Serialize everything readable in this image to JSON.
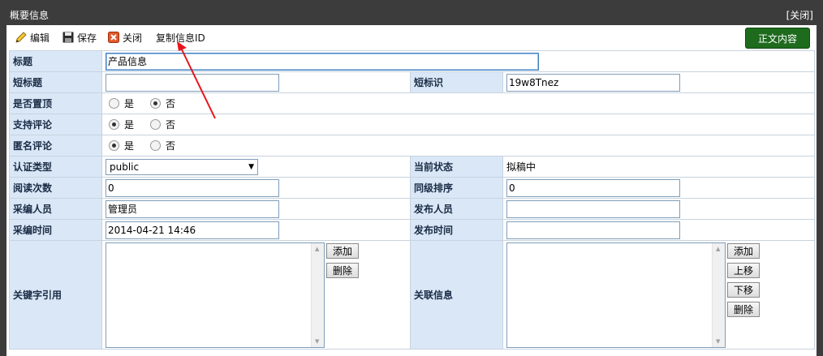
{
  "window": {
    "title": "概要信息",
    "close_label": "[关闭]"
  },
  "toolbar": {
    "edit": "编辑",
    "save": "保存",
    "close": "关闭",
    "copy_id": "复制信息ID",
    "content": "正文内容"
  },
  "form": {
    "title": {
      "label": "标题",
      "value": "产品信息"
    },
    "short_title": {
      "label": "短标题",
      "value": ""
    },
    "short_id": {
      "label": "短标识",
      "value": "19w8Tnez"
    },
    "pinned": {
      "label": "是否置顶",
      "yes": "是",
      "no": "否",
      "selected": "否"
    },
    "allow_comment": {
      "label": "支持评论",
      "yes": "是",
      "no": "否",
      "selected": "是"
    },
    "anonymous_comment": {
      "label": "匿名评论",
      "yes": "是",
      "no": "否",
      "selected": "是"
    },
    "auth_type": {
      "label": "认证类型",
      "value": "public"
    },
    "status": {
      "label": "当前状态",
      "value": "拟稿中"
    },
    "read_count": {
      "label": "阅读次数",
      "value": "0"
    },
    "sibling_order": {
      "label": "同级排序",
      "value": "0"
    },
    "editor": {
      "label": "采编人员",
      "value": "管理员"
    },
    "publisher": {
      "label": "发布人员",
      "value": ""
    },
    "edit_time": {
      "label": "采编时间",
      "value": "2014-04-21 14:46"
    },
    "publish_time": {
      "label": "发布时间",
      "value": ""
    },
    "keywords": {
      "label": "关键字引用",
      "add": "添加",
      "delete": "删除"
    },
    "related": {
      "label": "关联信息",
      "add": "添加",
      "move_up": "上移",
      "move_down": "下移",
      "delete": "删除"
    }
  },
  "colors": {
    "titlebar": "#3c3c3c",
    "label_bg": "#d9e7f7",
    "content_button": "#1e6b1e",
    "arrow": "#e8141c"
  }
}
